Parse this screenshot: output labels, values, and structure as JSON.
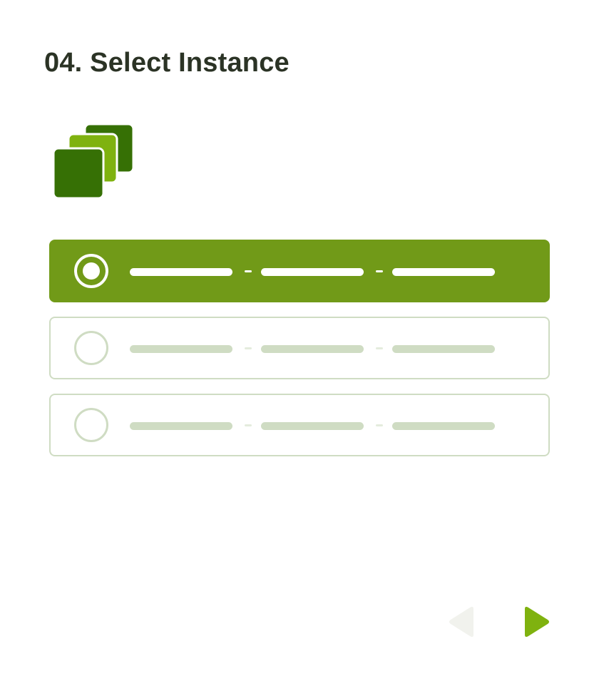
{
  "title": "04. Select Instance",
  "colors": {
    "accent": "#719a18",
    "dark_green": "#367005",
    "light_green": "#7fb20f",
    "inactive": "#cfdcc3",
    "title": "#2b3325",
    "prev_disabled": "#f1f2ed"
  },
  "header_icon": "stacked-squares-icon",
  "options": [
    {
      "state": "selected",
      "fields": 3
    },
    {
      "state": "unselected",
      "fields": 3
    },
    {
      "state": "unselected",
      "fields": 3
    }
  ],
  "navigation": {
    "prev_icon": "triangle-left-icon",
    "next_icon": "triangle-right-icon",
    "prev_enabled": false,
    "next_enabled": true
  }
}
